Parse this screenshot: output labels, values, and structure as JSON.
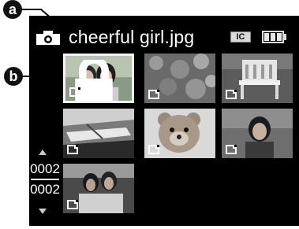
{
  "callouts": {
    "a": "a",
    "b": "b"
  },
  "header": {
    "mode_icon": "camera-icon",
    "filename": "cheerful girl.jpg",
    "storage_badge": "IC",
    "battery_icon": "battery-full-icon"
  },
  "thumbnails": [
    {
      "id": "cheerful-girls",
      "selected": true,
      "protected": true
    },
    {
      "id": "flowers",
      "selected": false,
      "protected": false
    },
    {
      "id": "bench",
      "selected": false,
      "protected": false
    },
    {
      "id": "boat",
      "selected": false,
      "protected": false
    },
    {
      "id": "teddy-bear",
      "selected": false,
      "protected": false
    },
    {
      "id": "woman-smiling",
      "selected": false,
      "protected": false
    },
    {
      "id": "couple-outdoors",
      "selected": false,
      "protected": false
    }
  ],
  "pager": {
    "current": "0002",
    "total": "0002"
  }
}
